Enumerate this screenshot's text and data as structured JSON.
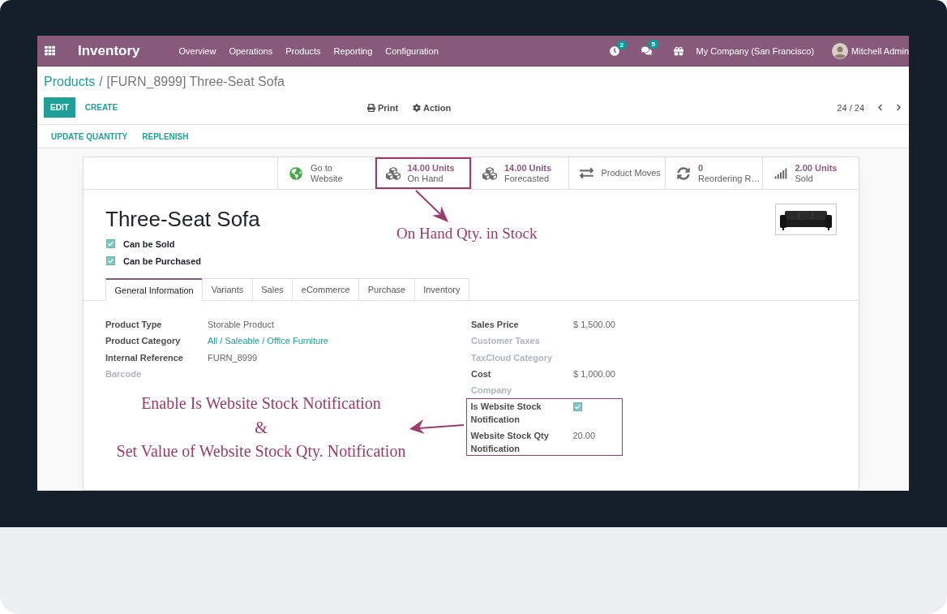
{
  "navbar": {
    "app": "Inventory",
    "menu": [
      "Overview",
      "Operations",
      "Products",
      "Reporting",
      "Configuration"
    ],
    "systray": [
      {
        "kind": "activity",
        "badge": "2"
      },
      {
        "kind": "messages",
        "badge": "5"
      },
      {
        "kind": "gift"
      }
    ],
    "company": "My Company (San Francisco)",
    "user": "Mitchell Admin"
  },
  "breadcrumb": {
    "parent": "Products",
    "separator": "/",
    "current": "[FURN_8999] Three-Seat Sofa"
  },
  "buttons": [
    {
      "label": "EDIT",
      "kind": "primary"
    },
    {
      "label": "CREATE",
      "kind": "link"
    }
  ],
  "action_menus": [
    {
      "label": "Print",
      "kind": "print"
    },
    {
      "label": "Action",
      "kind": "gear"
    }
  ],
  "pager": "24 / 24",
  "header_buttons": [
    "UPDATE QUANTITY",
    "REPLENISH"
  ],
  "smart_buttons": [
    {
      "kind": "globe",
      "highlighted": false,
      "labels": [
        "Go to",
        "Website"
      ]
    },
    {
      "kind": "cubes",
      "highlighted": true,
      "value": "14.00 Units",
      "labels": [
        "On Hand"
      ]
    },
    {
      "kind": "cubes",
      "highlighted": false,
      "value": "14.00 Units",
      "labels": [
        "Forecasted"
      ]
    },
    {
      "kind": "moves",
      "highlighted": false,
      "labels": [
        "Product Moves"
      ]
    },
    {
      "kind": "refresh",
      "highlighted": false,
      "value": "0",
      "labels": [
        "Reordering R…"
      ]
    },
    {
      "kind": "signal",
      "highlighted": false,
      "value": "2.00 Units",
      "labels": [
        "Sold"
      ]
    }
  ],
  "product": {
    "name": "Three-Seat Sofa",
    "options": [
      {
        "label": "Can be Sold",
        "checked": true
      },
      {
        "label": "Can be Purchased",
        "checked": true
      }
    ]
  },
  "tabs": [
    {
      "label": "General Information",
      "selected": true
    },
    {
      "label": "Variants",
      "selected": false
    },
    {
      "label": "Sales",
      "selected": false
    },
    {
      "label": "eCommerce",
      "selected": false
    },
    {
      "label": "Purchase",
      "selected": false
    },
    {
      "label": "Inventory",
      "selected": false
    }
  ],
  "general_fields": [
    {
      "label": "Product Type",
      "kind": "text",
      "value": "Storable Product"
    },
    {
      "label": "Product Category",
      "kind": "link",
      "value": "All / Saleable / Office Furniture"
    },
    {
      "label": "Internal Reference",
      "kind": "text",
      "value": "FURN_8999"
    },
    {
      "label": "Barcode",
      "kind": "empty"
    }
  ],
  "price_fields": [
    {
      "label": "Sales Price",
      "kind": "text",
      "value": "$ 1,500.00"
    },
    {
      "label": "Customer Taxes",
      "kind": "empty"
    },
    {
      "label": "TaxCloud Category",
      "kind": "empty"
    },
    {
      "label": "Cost",
      "kind": "text",
      "value": "$ 1,000.00"
    },
    {
      "label": "Company",
      "kind": "empty"
    }
  ],
  "notification_fields": [
    {
      "label": "Is Website Stock Notification",
      "kind": "checkbox",
      "checked": true
    },
    {
      "label": "Website Stock Qty Notification",
      "kind": "text",
      "value": "20.00"
    }
  ],
  "annotations": {
    "on_hand_note": "On Hand Qty. in Stock",
    "notification_note": [
      "Enable Is Website Stock Notification",
      "&",
      "Set Value of Website Stock Qty. Notification"
    ]
  }
}
